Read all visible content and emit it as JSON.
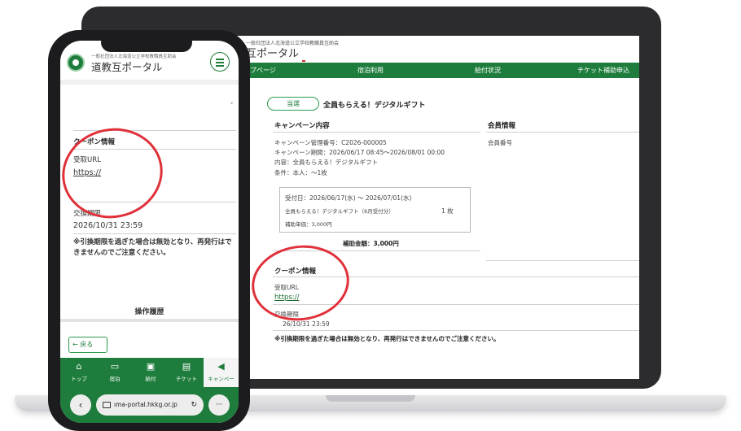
{
  "laptop": {
    "org_name": "一般社団法人北海道公立学校教職員互助会",
    "brand_partial": "互ポータル",
    "nav": [
      "ップページ",
      "宿泊利用",
      "給付状況",
      "チケット補助申込"
    ],
    "campaign": {
      "status_badge": "当選",
      "title": "全員もらえる！デジタルギフト",
      "section_heading": "キャンペーン内容",
      "mgmt_no": "キャンペーン管理番号：C2026-000005",
      "period": "キャンペーン期間：2026/06/17 08:45〜2026/08/01 00:00",
      "content": "内容：全員もらえる！デジタルギフト",
      "condition": "条件：本人：〜1枚",
      "box": {
        "reception": "受付日：2026/06/17(水) 〜 2026/07/01(水)",
        "item": "全員もらえる！デジタルギフト（6月受付分）",
        "qty": "1 枚",
        "unit_price": "補助単価：3,000円"
      },
      "total": "補助金額：3,000円"
    },
    "member": {
      "heading": "会員情報",
      "no_label": "会員番号"
    },
    "coupon": {
      "heading": "クーポン情報",
      "url_label": "受取URL",
      "url": "https://",
      "expiry_label": "交換期限",
      "expiry_partial": "26/10/31 23:59",
      "warning": "※引換期限を過ぎた場合は無効となり、再発行はできませんのでご注意ください。"
    }
  },
  "phone": {
    "org_name": "一般社団法人北海道公立学校教職員互助会",
    "brand": "道教互ポータル",
    "dash": "-",
    "coupon": {
      "heading": "クーポン情報",
      "url_label": "受取URL",
      "url": "https://",
      "expiry_label": "交換期限",
      "expiry": "2026/10/31 23:59",
      "warning": "※引換期限を過ぎた場合は無効となり、再発行はできませんのでご注意ください。"
    },
    "history_heading": "操作履歴",
    "back_label": "戻る",
    "tabs": [
      {
        "icon": "home-icon",
        "glyph": "⌂",
        "label": "トップ"
      },
      {
        "icon": "bed-icon",
        "glyph": "▭",
        "label": "宿泊"
      },
      {
        "icon": "gift-icon",
        "glyph": "▣",
        "label": "給付"
      },
      {
        "icon": "ticket-icon",
        "glyph": "▤",
        "label": "チケット"
      },
      {
        "icon": "megaphone-icon",
        "glyph": "◀",
        "label": "キャンペー"
      }
    ],
    "browser": {
      "url": "ıma-portal.hkkg.or.jp",
      "back_glyph": "‹",
      "more_glyph": "···",
      "reload_glyph": "↻"
    }
  },
  "colors": {
    "brand_green": "#1e7d3c",
    "annotation_red": "#e0313a"
  }
}
